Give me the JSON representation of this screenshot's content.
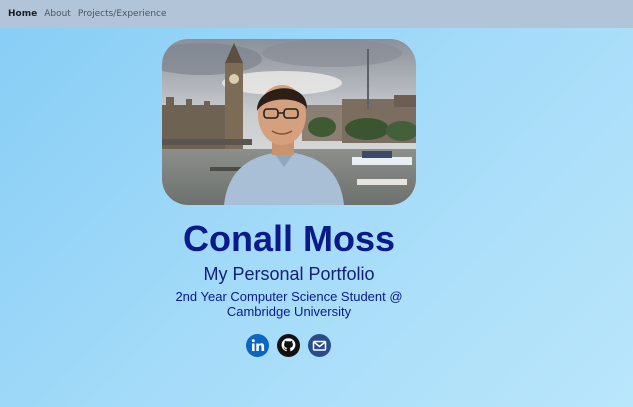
{
  "nav": {
    "items": [
      {
        "label": "Home",
        "active": true
      },
      {
        "label": "About",
        "active": false
      },
      {
        "label": "Projects/Experience",
        "active": false
      }
    ]
  },
  "hero": {
    "name": "Conall Moss",
    "subtitle": "My Personal Portfolio",
    "tagline": "2nd Year Computer Science Student @ Cambridge University"
  },
  "socials": [
    {
      "icon": "linkedin-icon",
      "color": "#0a66c2"
    },
    {
      "icon": "github-icon",
      "color": "#111111"
    },
    {
      "icon": "email-icon",
      "color": "#2b4c8c"
    }
  ],
  "colors": {
    "navbar": "#b2c4d8",
    "heading": "#0a1a8a"
  }
}
